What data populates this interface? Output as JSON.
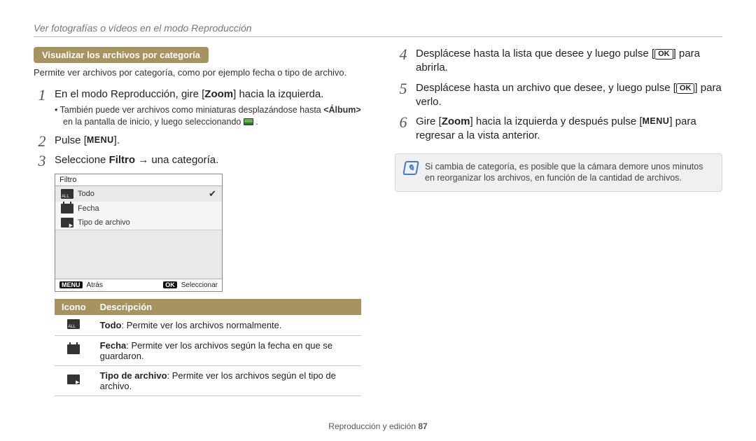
{
  "header": {
    "breadcrumb": "Ver fotografías o vídeos en el modo Reproducción"
  },
  "section": {
    "pill": "Visualizar los archivos por categoría",
    "subtitle": "Permite ver archivos por categoría, como por ejemplo fecha o tipo de archivo."
  },
  "left_steps": {
    "s1_a": "En el modo Reproducción, gire [",
    "s1_b": "Zoom",
    "s1_c": "] hacia la izquierda.",
    "s1_sub_a": "También puede ver archivos como miniaturas desplazándose hasta ",
    "s1_sub_b": "<Álbum>",
    "s1_sub_c": " en la pantalla de inicio, y luego seleccionando ",
    "s1_sub_d": " .",
    "s2_a": "Pulse [",
    "s2_b": "MENU",
    "s2_c": "].",
    "s3_a": "Seleccione ",
    "s3_b": "Filtro",
    "s3_c": " → una categoría."
  },
  "camera_ui": {
    "title": "Filtro",
    "items": {
      "todo": "Todo",
      "fecha": "Fecha",
      "tipo": "Tipo de archivo"
    },
    "footer": {
      "back_key": "MENU",
      "back_label": "Atrás",
      "sel_key": "OK",
      "sel_label": "Seleccionar"
    }
  },
  "table": {
    "h_icon": "Icono",
    "h_desc": "Descripción",
    "r1_b": "Todo",
    "r1_t": ": Permite ver los archivos normalmente.",
    "r2_b": "Fecha",
    "r2_t": ": Permite ver los archivos según la fecha en que se guardaron.",
    "r3_b": "Tipo de archivo",
    "r3_t": ": Permite ver los archivos según el tipo de archivo."
  },
  "right_steps": {
    "s4_a": "Desplácese hasta la lista que desee y luego pulse [",
    "s4_b": "OK",
    "s4_c": "] para abrirla.",
    "s5_a": "Desplácese hasta un archivo que desee, y luego pulse [",
    "s5_b": "OK",
    "s5_c": "] para verlo.",
    "s6_a": "Gire [",
    "s6_b": "Zoom",
    "s6_c": "] hacia la izquierda y después pulse [",
    "s6_d": "MENU",
    "s6_e": "] para regresar a la vista anterior."
  },
  "note": "Si cambia de categoría, es posible que la cámara demore unos minutos en reorganizar los archivos, en función de la cantidad de archivos.",
  "footer": {
    "section": "Reproducción y edición  ",
    "page": "87"
  }
}
